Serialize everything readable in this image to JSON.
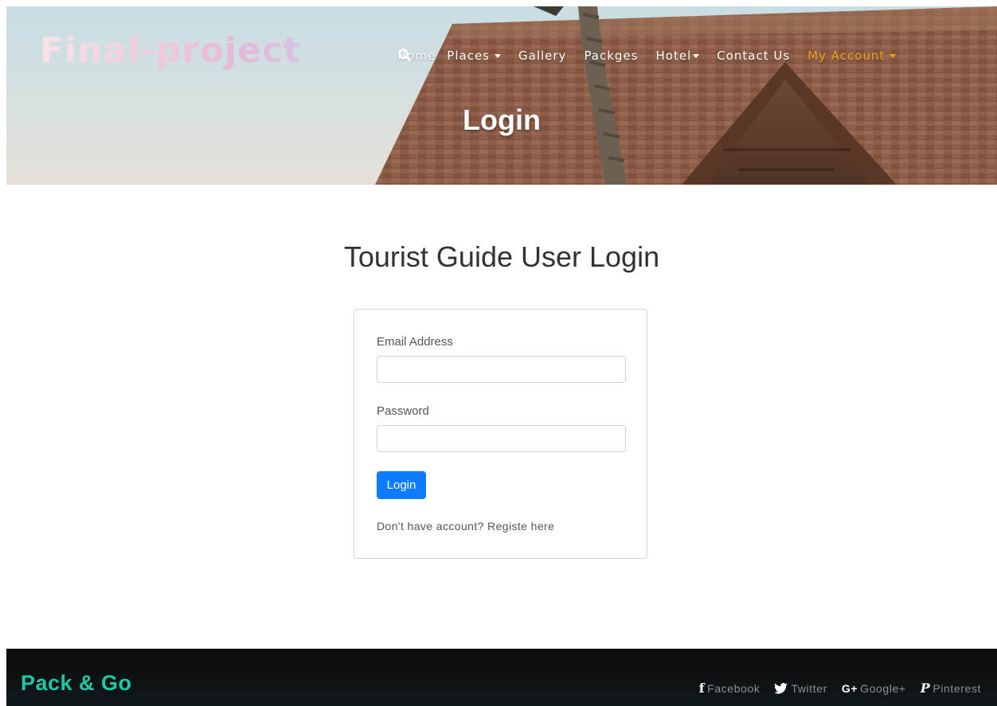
{
  "header": {
    "logo": "Final-project",
    "nav": [
      {
        "label": "Home",
        "dropdown": false,
        "active": false
      },
      {
        "label": "Places",
        "dropdown": true,
        "active": false
      },
      {
        "label": "Gallery",
        "dropdown": false,
        "active": false
      },
      {
        "label": "Packges",
        "dropdown": false,
        "active": false
      },
      {
        "label": "Hotel",
        "dropdown": true,
        "active": false
      },
      {
        "label": "Contact Us",
        "dropdown": false,
        "active": false
      },
      {
        "label": "My Account",
        "dropdown": true,
        "active": true
      }
    ],
    "search_icon": "search-icon",
    "hero_title": "Login"
  },
  "main": {
    "heading": "Tourist Guide User Login",
    "form": {
      "email_label": "Email Address",
      "email_value": "",
      "password_label": "Password",
      "password_value": "",
      "submit_label": "Login",
      "register_prefix": "Don't have account?",
      "register_link": "Registe here"
    }
  },
  "footer": {
    "brand": "Pack & Go",
    "social": [
      {
        "icon": "facebook-icon",
        "glyph": "f",
        "label": "Facebook"
      },
      {
        "icon": "twitter-icon",
        "glyph": "🐦",
        "label": "Twitter"
      },
      {
        "icon": "google-plus-icon",
        "glyph": "G+",
        "label": "Google+"
      },
      {
        "icon": "pinterest-icon",
        "glyph": "P",
        "label": "Pinterest"
      }
    ]
  },
  "colors": {
    "accent_nav_active": "#f6a31c",
    "button_primary": "#0d7cff",
    "footer_brand": "#1ec8a5",
    "footer_bg": "#0b0b0b"
  }
}
